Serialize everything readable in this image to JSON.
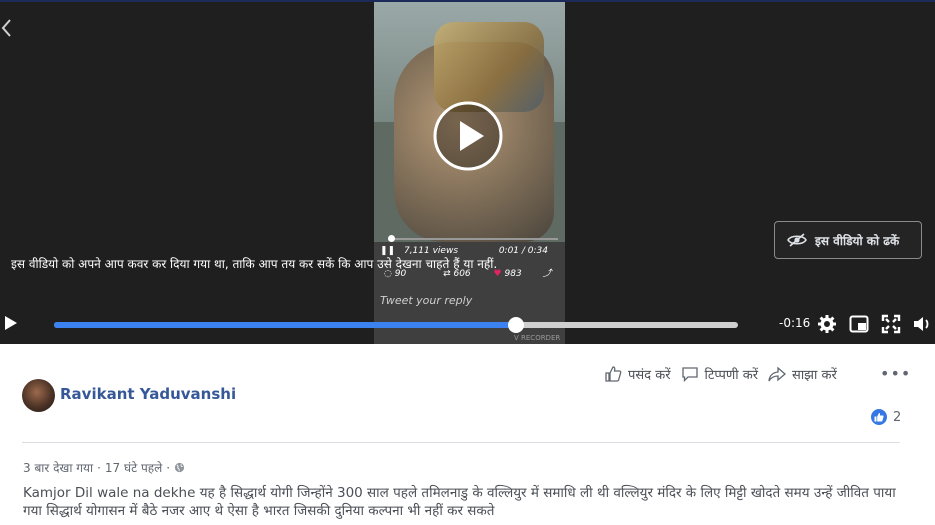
{
  "video": {
    "caption": "इस वीडियो को अपने आप कवर कर दिया गया था, ताकि आप तय कर सकें कि आप उसे देखना चाहते हैं या नहीं.",
    "cover_button_label": "इस वीडियो को ढकें",
    "time_remaining": "-0:16",
    "progress_fraction": 0.676,
    "embedded_tweet": {
      "views": "7,111 views",
      "time": "0:01 / 0:34",
      "replies": "90",
      "retweets": "606",
      "likes": "983",
      "reply_placeholder": "Tweet your reply",
      "recorder_label": "V RECORDER"
    }
  },
  "actions": {
    "like": "पसंद करें",
    "comment": "टिप्पणी करें",
    "share": "साझा करें"
  },
  "post": {
    "author": "Ravikant Yaduvanshi",
    "reaction_count": "2",
    "views": "3 बार देखा गया",
    "separator": "·",
    "time": "17 घंटे पहले",
    "description": "Kamjor Dil wale na dekhe यह है सिद्धार्थ योगी जिन्होंने 300 साल पहले तमिलनाडु के वल्लियुर में समाधि ली थी वल्लियुर मंदिर के लिए मिट्टी खोदते समय उन्हें जीवित पाया गया सिद्धार्थ योगासन में बैठे नजर आए थे ऐसा है भारत जिसकी दुनिया कल्पना भी नहीं कर सकते"
  },
  "colors": {
    "link": "#365899",
    "progress": "#3b82f0",
    "like": "#3578e5"
  }
}
